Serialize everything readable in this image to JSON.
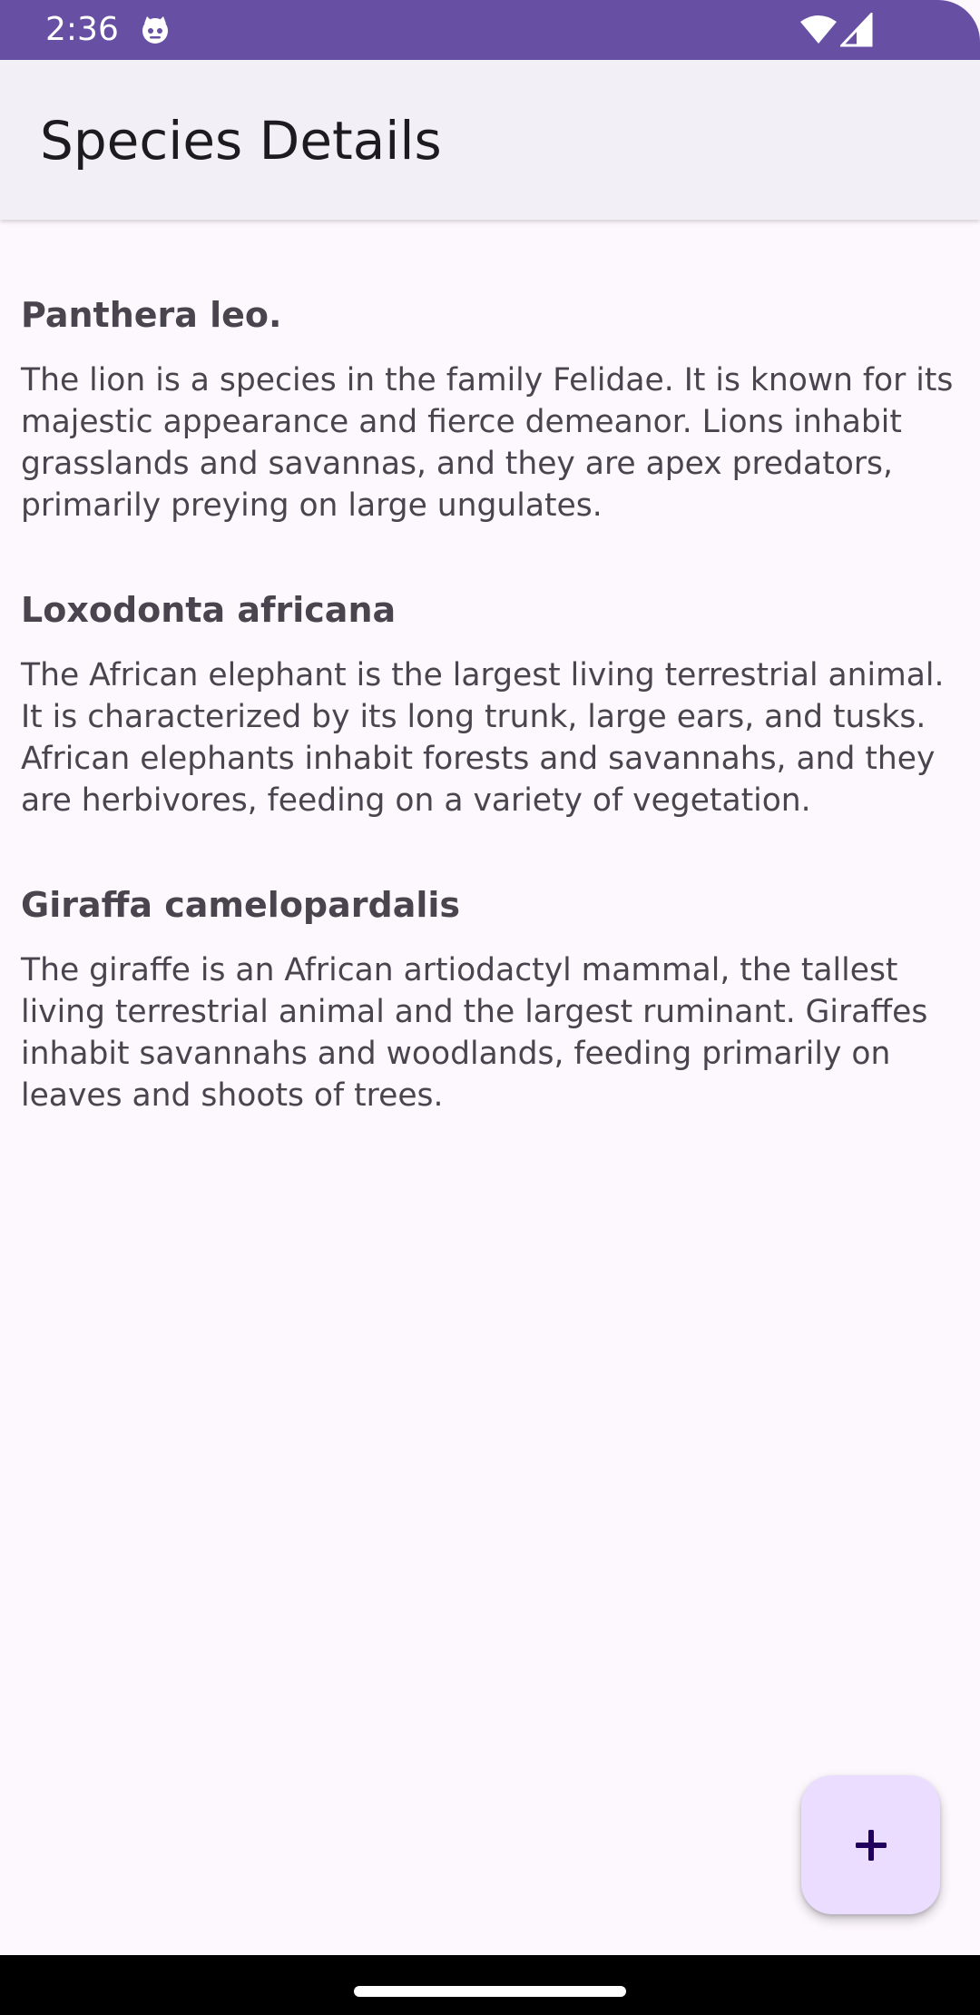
{
  "status_bar": {
    "time": "2:36",
    "icons": [
      "face-icon",
      "wifi-icon",
      "signal-icon"
    ],
    "color": "#6750A4"
  },
  "app_bar": {
    "title": "Species Details"
  },
  "species": [
    {
      "name": "Panthera leo.",
      "description": "The lion is a species in the family Felidae. It is known for its majestic appearance and fierce demeanor. Lions inhabit grasslands and savannas, and they are apex predators, primarily preying on large ungulates."
    },
    {
      "name": "Loxodonta africana",
      "description": "The African elephant is the largest living terrestrial animal. It is characterized by its long trunk, large ears, and tusks. African elephants inhabit forests and savannahs, and they are herbivores, feeding on a variety of vegetation."
    },
    {
      "name": "Giraffa camelopardalis",
      "description": "The giraffe is an African artiodactyl mammal, the tallest living terrestrial animal and the largest ruminant. Giraffes inhabit savannahs and woodlands, feeding primarily on leaves and shoots of trees."
    }
  ],
  "fab": {
    "icon": "plus-icon",
    "color": "#EADDFF"
  },
  "colors": {
    "background": "#FDF7FE",
    "app_bar": "#F3EFF7",
    "text": "#49454F",
    "title_text": "#1D1B20"
  }
}
